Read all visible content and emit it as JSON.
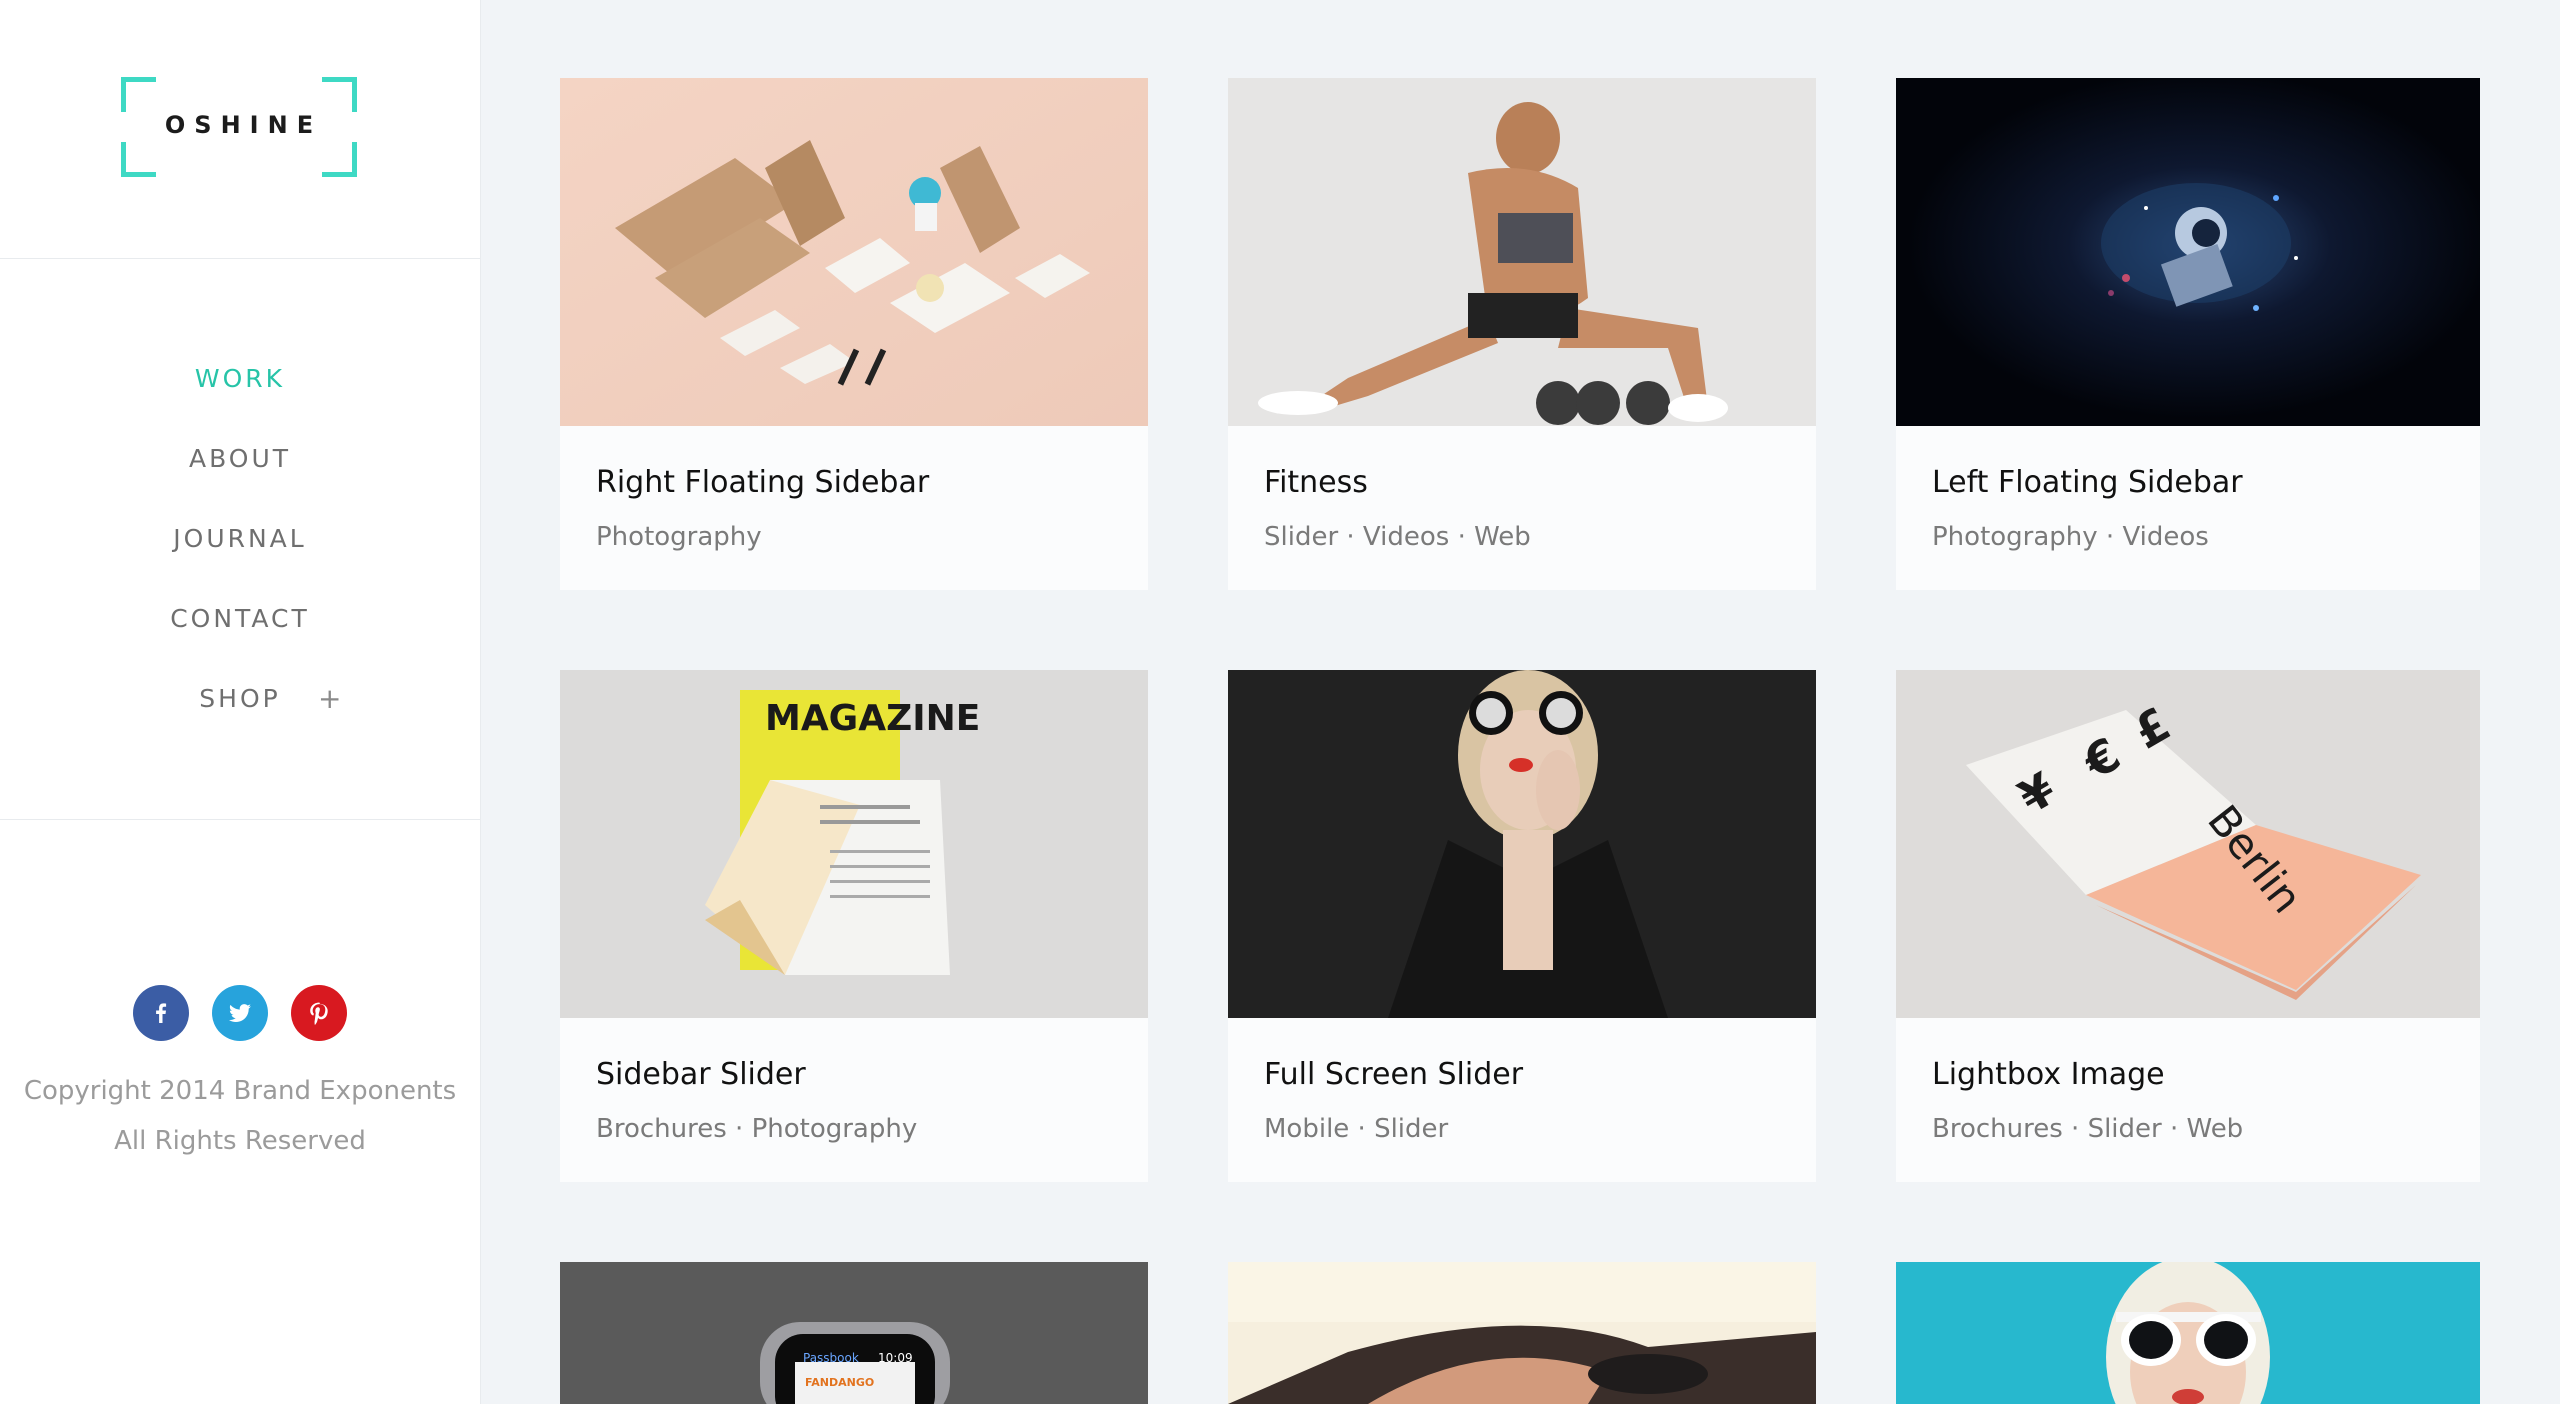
{
  "brand": {
    "logo_text": "OSHINE",
    "accent": "#27c4a8"
  },
  "nav": {
    "items": [
      {
        "label": "WORK",
        "active": true
      },
      {
        "label": "ABOUT"
      },
      {
        "label": "JOURNAL"
      },
      {
        "label": "CONTACT"
      },
      {
        "label": "SHOP",
        "has_submenu": true
      }
    ],
    "submenu_toggle": "+"
  },
  "social": [
    {
      "icon": "facebook-icon",
      "color": "#3b5da5"
    },
    {
      "icon": "twitter-icon",
      "color": "#27a3dc"
    },
    {
      "icon": "pinterest-icon",
      "color": "#d81920"
    }
  ],
  "footer": {
    "copyright_line1": "Copyright 2014 Brand Exponents",
    "copyright_line2": "All Rights Reserved"
  },
  "portfolio": [
    {
      "title": "Right Floating Sidebar",
      "tags": "Photography"
    },
    {
      "title": "Fitness",
      "tags": "Slider · Videos · Web"
    },
    {
      "title": "Left Floating Sidebar",
      "tags": "Photography · Videos"
    },
    {
      "title": "Sidebar Slider",
      "tags": "Brochures · Photography"
    },
    {
      "title": "Full Screen Slider",
      "tags": "Mobile · Slider"
    },
    {
      "title": "Lightbox Image",
      "tags": "Brochures · Slider · Web"
    },
    {
      "title": "",
      "tags": ""
    },
    {
      "title": "",
      "tags": ""
    },
    {
      "title": "",
      "tags": ""
    }
  ],
  "thumb_texts": {
    "magazine": "MAGAZINE",
    "berlin": "Berlin",
    "watch_app": "Passbook",
    "watch_time": "10:09",
    "watch_ticket": "FANDANGO"
  }
}
